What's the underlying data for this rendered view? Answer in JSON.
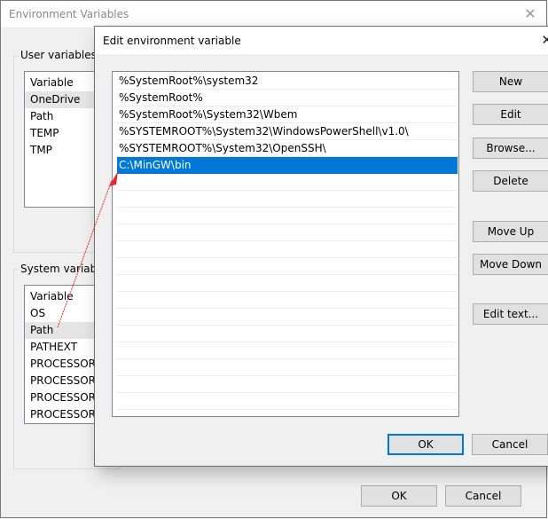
{
  "env_window": {
    "title": "Environment Variables",
    "close_icon": "close-icon",
    "user_group_label": "User variables fo",
    "user_vars": {
      "header": "Variable",
      "rows": [
        "OneDrive",
        "Path",
        "TEMP",
        "TMP"
      ],
      "highlighted_index": 0
    },
    "system_group_label": "System variables",
    "system_vars": {
      "header": "Variable",
      "rows": [
        "OS",
        "Path",
        "PATHEXT",
        "PROCESSOR_A",
        "PROCESSOR_I",
        "PROCESSOR_L",
        "PROCESSOR_R"
      ],
      "highlighted_index": 1
    },
    "ok_label": "OK",
    "cancel_label": "Cancel"
  },
  "edit_dialog": {
    "title": "Edit environment variable",
    "close_icon": "close-icon",
    "entries": [
      "%SystemRoot%\\system32",
      "%SystemRoot%",
      "%SystemRoot%\\System32\\Wbem",
      "%SYSTEMROOT%\\System32\\WindowsPowerShell\\v1.0\\",
      "%SYSTEMROOT%\\System32\\OpenSSH\\",
      "C:\\MinGW\\bin"
    ],
    "selected_index": 5,
    "buttons": {
      "new": "New",
      "edit": "Edit",
      "browse": "Browse...",
      "delete": "Delete",
      "move_up": "Move Up",
      "move_down": "Move Down",
      "edit_text": "Edit text..."
    },
    "ok_label": "OK",
    "cancel_label": "Cancel"
  },
  "colors": {
    "selection": "#0078d7",
    "annotation_arrow": "#e8272a"
  }
}
